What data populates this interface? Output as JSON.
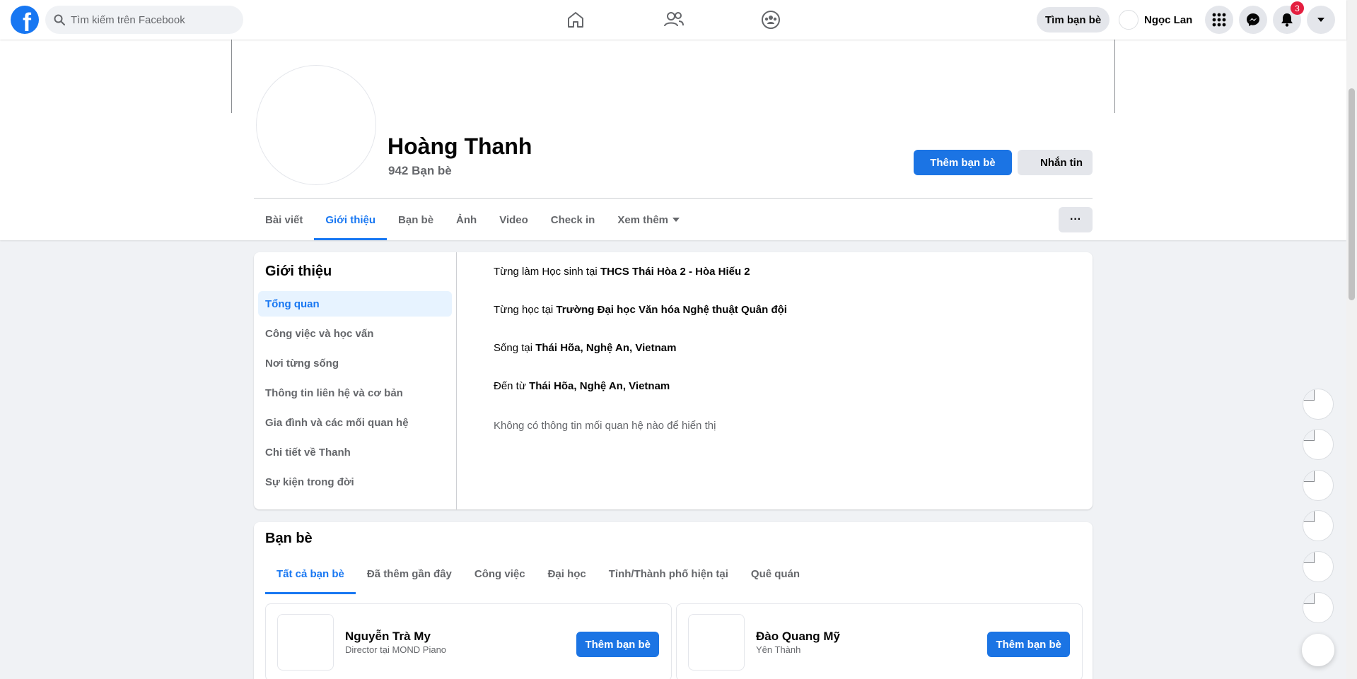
{
  "topbar": {
    "logo_letter": "f",
    "search_placeholder": "Tìm kiếm trên Facebook",
    "find_friends": "Tìm bạn bè",
    "user_name": "Ngọc Lan",
    "notification_count": "3"
  },
  "profile": {
    "name": "Hoàng Thanh",
    "friends_count": "942 Bạn bè",
    "add_friend": "Thêm bạn bè",
    "message": "Nhắn tin",
    "more": "···",
    "tabs": [
      "Bài viết",
      "Giới thiệu",
      "Bạn bè",
      "Ảnh",
      "Video",
      "Check in",
      "Xem thêm"
    ]
  },
  "about": {
    "title": "Giới thiệu",
    "nav": [
      "Tổng quan",
      "Công việc và học vấn",
      "Nơi từng sống",
      "Thông tin liên hệ và cơ bản",
      "Gia đình và các mối quan hệ",
      "Chi tiết về Thanh",
      "Sự kiện trong đời"
    ],
    "info": [
      {
        "prefix": "Từng làm Học sinh tại ",
        "value": "THCS Thái Hòa 2 - Hòa Hiếu 2"
      },
      {
        "prefix": "Từng học tại ",
        "value": "Trường Đại học Văn hóa Nghệ thuật Quân đội"
      },
      {
        "prefix": "Sống tại ",
        "value": "Thái Hõa, Nghệ An, Vietnam"
      },
      {
        "prefix": "Đến từ ",
        "value": "Thái Hõa, Nghệ An, Vietnam"
      }
    ],
    "empty_relationship": "Không có thông tin mối quan hệ nào để hiển thị"
  },
  "friends": {
    "title": "Bạn bè",
    "tabs": [
      "Tất cả bạn bè",
      "Đã thêm gần đây",
      "Công việc",
      "Đại học",
      "Tỉnh/Thành phố hiện tại",
      "Quê quán"
    ],
    "items": [
      {
        "name": "Nguyễn Trà My",
        "sub": "Director tại MOND Piano",
        "button": "Thêm bạn bè"
      },
      {
        "name": "Đào Quang Mỹ",
        "sub": "Yên Thành",
        "button": "Thêm bạn bè"
      }
    ]
  },
  "colors": {
    "accent": "#1877f2",
    "button_blue": "#1b74e4",
    "badge_red": "#e41e3f"
  }
}
